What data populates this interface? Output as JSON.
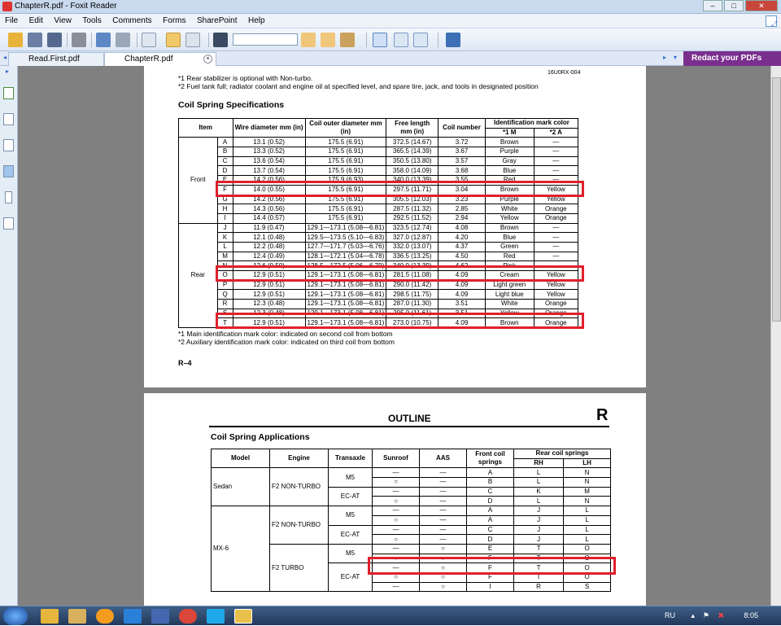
{
  "window": {
    "title": "ChapterR.pdf - Foxit Reader"
  },
  "menu": [
    "File",
    "Edit",
    "View",
    "Tools",
    "Comments",
    "Forms",
    "SharePoint",
    "Help"
  ],
  "tabs": [
    {
      "label": "Read.First.pdf"
    },
    {
      "label": "ChapterR.pdf"
    }
  ],
  "redact_banner": "Redact your PDFs",
  "page1": {
    "note1": "*1 Rear stabilizer is optional with Non-turbo.",
    "note2": "*2 Fuel tank full; radiator coolant and engine oil at specified level, and spare tire, jack, and tools in designated position",
    "ref_top": "16U0RX-004",
    "title": "Coil Spring Specifications",
    "headers": {
      "item": "Item",
      "wire": "Wire diameter mm (in)",
      "outer": "Coil outer diameter mm (in)",
      "free": "Free length mm (in)",
      "coil": "Coil number",
      "ident": "Identification mark color",
      "m1": "*1 M",
      "m2": "*2 A"
    },
    "groups": {
      "front": "Front",
      "rear": "Rear"
    },
    "rows": [
      [
        "A",
        "13.1 (0.52)",
        "175.5 (6.91)",
        "372.5 (14.67)",
        "3.72",
        "Brown",
        "—"
      ],
      [
        "B",
        "13.3 (0.52)",
        "175.5 (6.91)",
        "365.5 (14.39)",
        "3.67",
        "Purple",
        "—"
      ],
      [
        "C",
        "13.6 (0.54)",
        "175.5 (6.91)",
        "350.5 (13.80)",
        "3.57",
        "Gray",
        "—"
      ],
      [
        "D",
        "13.7 (0.54)",
        "175.5 (6.91)",
        "358.0 (14.09)",
        "3.68",
        "Blue",
        "—"
      ],
      [
        "E",
        "14.2 (0.56)",
        "175.9 (6.93)",
        "340.0 (13.39)",
        "3.55",
        "Red",
        "—"
      ],
      [
        "F",
        "14.0 (0.55)",
        "175.5 (6.91)",
        "297.5 (11.71)",
        "3.04",
        "Brown",
        "Yellow"
      ],
      [
        "G",
        "14.2 (0.56)",
        "175.5 (6.91)",
        "305.5 (12.03)",
        "3.23",
        "Purple",
        "Yellow"
      ],
      [
        "H",
        "14.3 (0.56)",
        "175.5 (6.91)",
        "287.5 (11.32)",
        "2.85",
        "White",
        "Orange"
      ],
      [
        "I",
        "14.4 (0.57)",
        "175.5 (6.91)",
        "292.5 (11.52)",
        "2.94",
        "Yellow",
        "Orange"
      ],
      [
        "J",
        "11.9 (0.47)",
        "129.1—173.1 (5.08—6.81)",
        "323.5 (12.74)",
        "4.08",
        "Brown",
        "—"
      ],
      [
        "K",
        "12.1 (0.48)",
        "129.5—173.5 (5.10—6.83)",
        "327.0 (12.87)",
        "4.20",
        "Blue",
        "—"
      ],
      [
        "L",
        "12.2 (0.48)",
        "127.7—171.7 (5.03—6.76)",
        "332.0 (13.07)",
        "4.37",
        "Green",
        "—"
      ],
      [
        "M",
        "12.4 (0.49)",
        "128.1—172.1 (5.04—6.78)",
        "336.5 (13.25)",
        "4.50",
        "Red",
        "—"
      ],
      [
        "N",
        "12.6 (0.50)",
        "128.5—172.5 (5.06—6.79)",
        "340.0 (13.39)",
        "4.62",
        "Pink",
        "—"
      ],
      [
        "O",
        "12.9 (0.51)",
        "129.1—173.1 (5.08—6.81)",
        "281.5 (11.08)",
        "4.09",
        "Cream",
        "Yellow"
      ],
      [
        "P",
        "12.9 (0.51)",
        "129.1—173.1 (5.08—6.81)",
        "290.0 (11.42)",
        "4.09",
        "Light green",
        "Yellow"
      ],
      [
        "Q",
        "12.9 (0.51)",
        "129.1—173.1 (5.08—6.81)",
        "298.5 (11.75)",
        "4.09",
        "Light blue",
        "Yellow"
      ],
      [
        "R",
        "12.3 (0.48)",
        "129.1—173.1 (5.08—6.81)",
        "287.0 (11.30)",
        "3.51",
        "White",
        "Orange"
      ],
      [
        "S",
        "12.3 (0.48)",
        "129.1—173.1 (5.08—6.81)",
        "295.0 (11.61)",
        "3.51",
        "Yellow",
        "Orange"
      ],
      [
        "T",
        "12.9 (0.51)",
        "129.1—173.1 (5.08—6.81)",
        "273.0 (10.75)",
        "4.09",
        "Brown",
        "Orange"
      ]
    ],
    "foot1": "*1 Main identification mark color: indicated on second coil from bottom",
    "foot2": "*2 Auxiliary identification mark color: indicated on third coil from bottom",
    "page_no": "R–4"
  },
  "page2": {
    "outline": "OUTLINE",
    "letter": "R",
    "title": "Coil Spring Applications",
    "headers": {
      "model": "Model",
      "engine": "Engine",
      "trans": "Transaxle",
      "sunroof": "Sunroof",
      "aas": "AAS",
      "front": "Front coil springs",
      "rear": "Rear coil springs",
      "rh": "RH",
      "lh": "LH"
    },
    "models": {
      "sedan": "Sedan",
      "mx6": "MX-6"
    },
    "engines": {
      "nonturbo": "F2 NON-TURBO",
      "turbo": "F2 TURBO"
    },
    "trans": {
      "m5": "M5",
      "ecat": "EC-AT"
    },
    "rows": [
      [
        "—",
        "—",
        "A",
        "L",
        "N"
      ],
      [
        "○",
        "—",
        "B",
        "L",
        "N"
      ],
      [
        "—",
        "—",
        "C",
        "K",
        "M"
      ],
      [
        "○",
        "—",
        "D",
        "L",
        "N"
      ],
      [
        "—",
        "—",
        "A",
        "J",
        "L"
      ],
      [
        "○",
        "—",
        "A",
        "J",
        "L"
      ],
      [
        "—",
        "—",
        "C",
        "J",
        "L"
      ],
      [
        "○",
        "—",
        "D",
        "J",
        "L"
      ],
      [
        "—",
        "○",
        "E",
        "T",
        "O"
      ],
      [
        "○",
        "○",
        "F",
        "T",
        "O"
      ],
      [
        "—",
        "○",
        "F",
        "T",
        "O"
      ],
      [
        "○",
        "○",
        "F",
        "T",
        "O"
      ],
      [
        "—",
        "○",
        "I",
        "R",
        "S"
      ]
    ]
  },
  "taskbar": {
    "lang": "RU",
    "time": "8:05"
  }
}
